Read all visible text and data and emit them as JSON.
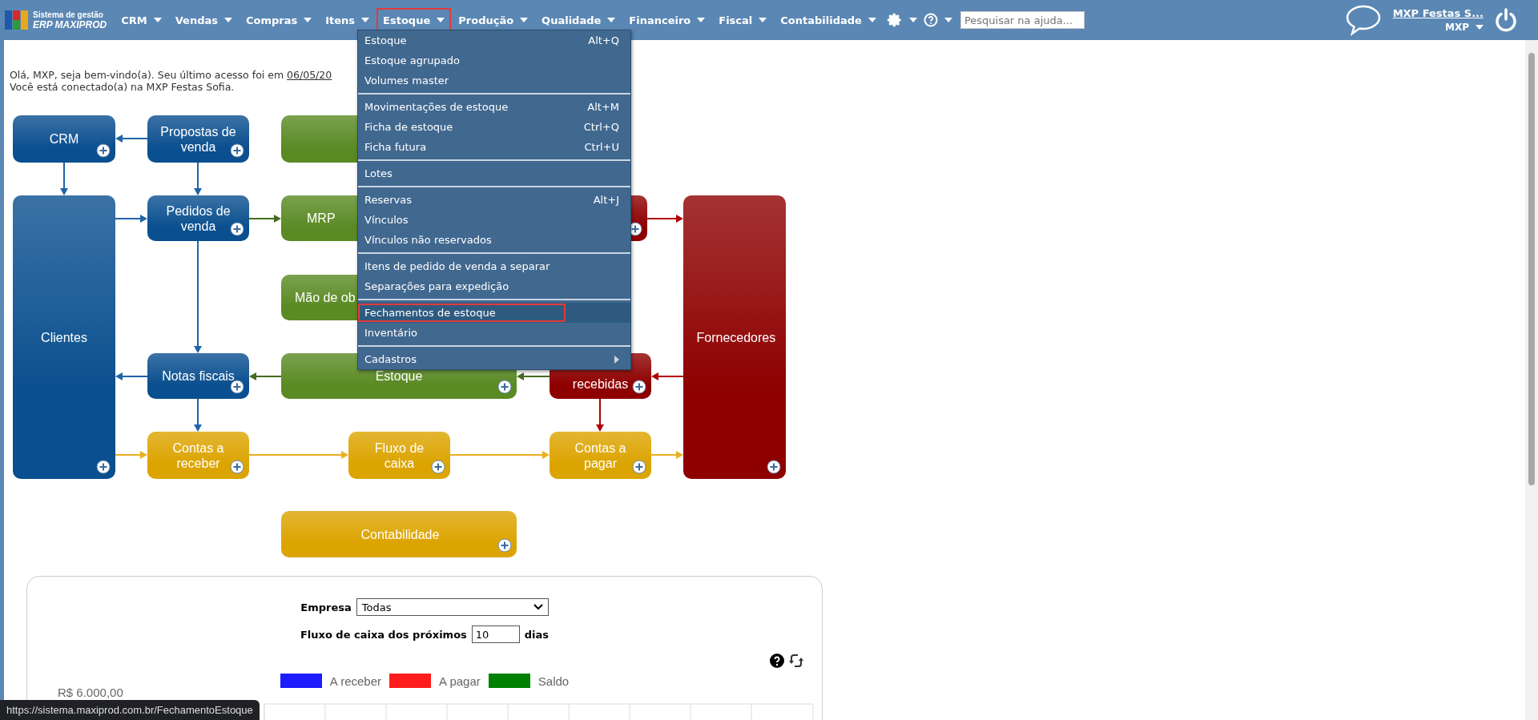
{
  "header": {
    "logo": {
      "line1": "Sistema de gestão",
      "line2": "ERP MAXIPROD"
    },
    "nav": [
      {
        "label": "CRM",
        "selected": false
      },
      {
        "label": "Vendas",
        "selected": false
      },
      {
        "label": "Compras",
        "selected": false
      },
      {
        "label": "Itens",
        "selected": false
      },
      {
        "label": "Estoque",
        "selected": true
      },
      {
        "label": "Produção",
        "selected": false
      },
      {
        "label": "Qualidade",
        "selected": false
      },
      {
        "label": "Financeiro",
        "selected": false
      },
      {
        "label": "Fiscal",
        "selected": false
      },
      {
        "label": "Contabilidade",
        "selected": false
      }
    ],
    "search": {
      "placeholder": "Pesquisar na ajuda..."
    },
    "company_link": "MXP Festas S...",
    "user": "MXP"
  },
  "menu": {
    "groups": [
      [
        {
          "label": "Estoque",
          "shortcut": "Alt+Q",
          "selected": false
        },
        {
          "label": "Estoque agrupado",
          "selected": false
        },
        {
          "label": "Volumes master",
          "selected": false
        }
      ],
      [
        {
          "label": "Movimentações de estoque",
          "shortcut": "Alt+M",
          "selected": false
        },
        {
          "label": "Ficha de estoque",
          "shortcut": "Ctrl+Q",
          "selected": false
        },
        {
          "label": "Ficha futura",
          "shortcut": "Ctrl+U",
          "selected": false
        }
      ],
      [
        {
          "label": "Lotes",
          "selected": false
        }
      ],
      [
        {
          "label": "Reservas",
          "shortcut": "Alt+J",
          "selected": false
        },
        {
          "label": "Vínculos",
          "selected": false
        },
        {
          "label": "Vínculos não reservados",
          "selected": false
        }
      ],
      [
        {
          "label": "Itens de pedido de venda a separar",
          "selected": false
        },
        {
          "label": "Separações para expedição",
          "selected": false
        }
      ],
      [
        {
          "label": "Fechamentos de estoque",
          "selected": true
        },
        {
          "label": "Inventário",
          "selected": false
        }
      ],
      [
        {
          "label": "Cadastros",
          "submenu": true,
          "selected": false
        }
      ]
    ]
  },
  "greeting": {
    "line1": "Olá, MXP, seja bem-vindo(a). Seu último acesso foi em ",
    "date": "06/05/20",
    "line2": "Você está conectado(a) na MXP Festas Sofia."
  },
  "diagram": {
    "nodes": [
      {
        "label": "CRM",
        "color": "#0a4f8f"
      },
      {
        "label": "Propostas de venda",
        "color": "#0a4f8f"
      },
      {
        "color": "#5a8a24"
      },
      {
        "label": "Clientes",
        "color": "#0a4f8f"
      },
      {
        "label": "Pedidos de venda",
        "color": "#0a4f8f"
      },
      {
        "label": "MRP",
        "color": "#5a8a24"
      },
      {
        "color": "#8e0000"
      },
      {
        "label": "Fornecedores",
        "color": "#8e0000"
      },
      {
        "label": "Mão de ob",
        "color": "#5a8a24"
      },
      {
        "label": "Notas fiscais",
        "color": "#0a4f8f"
      },
      {
        "label": "Estoque",
        "color": "#5a8a24"
      },
      {
        "label": "recebidas",
        "color": "#8e0000"
      },
      {
        "label": "Contas a receber",
        "color": "#dca400"
      },
      {
        "label": "Fluxo de caixa",
        "color": "#dca400"
      },
      {
        "label": "Contas a pagar",
        "color": "#dca400"
      },
      {
        "label": "Contabilidade",
        "color": "#dca400"
      }
    ]
  },
  "cash_flow": {
    "company_label": "Empresa",
    "company_value": "Todas",
    "days_label": "Fluxo de caixa dos próximos",
    "days_value": "10",
    "days_unit": "dias",
    "legend": [
      {
        "label": "A receber",
        "color": "#1c1cff"
      },
      {
        "label": "A pagar",
        "color": "#ff1c1c"
      },
      {
        "label": "Saldo",
        "color": "#008000"
      }
    ],
    "y_label": "R$ 6.000,00"
  },
  "status_url": "https://sistema.maxiprod.com.br/FechamentoEstoque"
}
